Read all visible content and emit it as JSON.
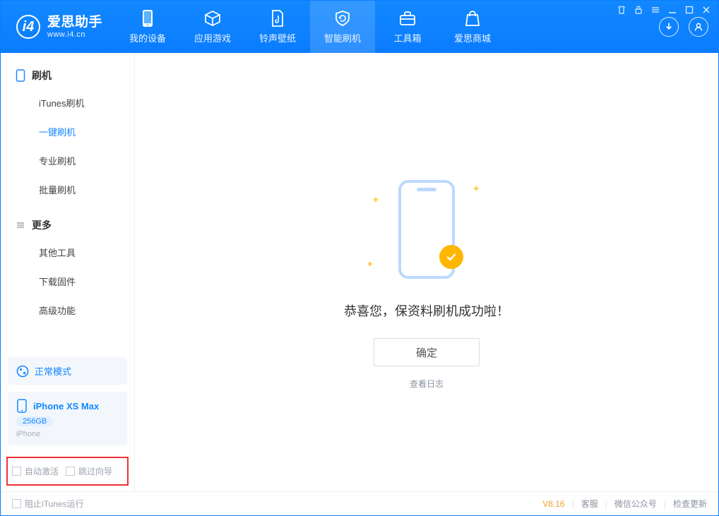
{
  "app": {
    "name": "爱思助手",
    "url": "www.i4.cn"
  },
  "nav": {
    "tabs": [
      {
        "label": "我的设备"
      },
      {
        "label": "应用游戏"
      },
      {
        "label": "铃声壁纸"
      },
      {
        "label": "智能刷机"
      },
      {
        "label": "工具箱"
      },
      {
        "label": "爱思商城"
      }
    ],
    "active_index": 3
  },
  "sidebar": {
    "group1": {
      "title": "刷机",
      "items": [
        {
          "label": "iTunes刷机"
        },
        {
          "label": "一键刷机"
        },
        {
          "label": "专业刷机"
        },
        {
          "label": "批量刷机"
        }
      ],
      "active_index": 1
    },
    "group2": {
      "title": "更多",
      "items": [
        {
          "label": "其他工具"
        },
        {
          "label": "下载固件"
        },
        {
          "label": "高级功能"
        }
      ]
    },
    "mode_card": {
      "label": "正常模式"
    },
    "device": {
      "name": "iPhone XS Max",
      "storage": "256GB",
      "type": "iPhone"
    },
    "bottom_checks": {
      "auto_activate": "自动激活",
      "skip_guide": "跳过向导"
    }
  },
  "main": {
    "success_text": "恭喜您，保资料刷机成功啦！",
    "ok_button": "确定",
    "view_log": "查看日志"
  },
  "footer": {
    "block_itunes": "阻止iTunes运行",
    "version": "V8.16",
    "links": {
      "support": "客服",
      "wechat": "微信公众号",
      "check_update": "检查更新"
    }
  }
}
